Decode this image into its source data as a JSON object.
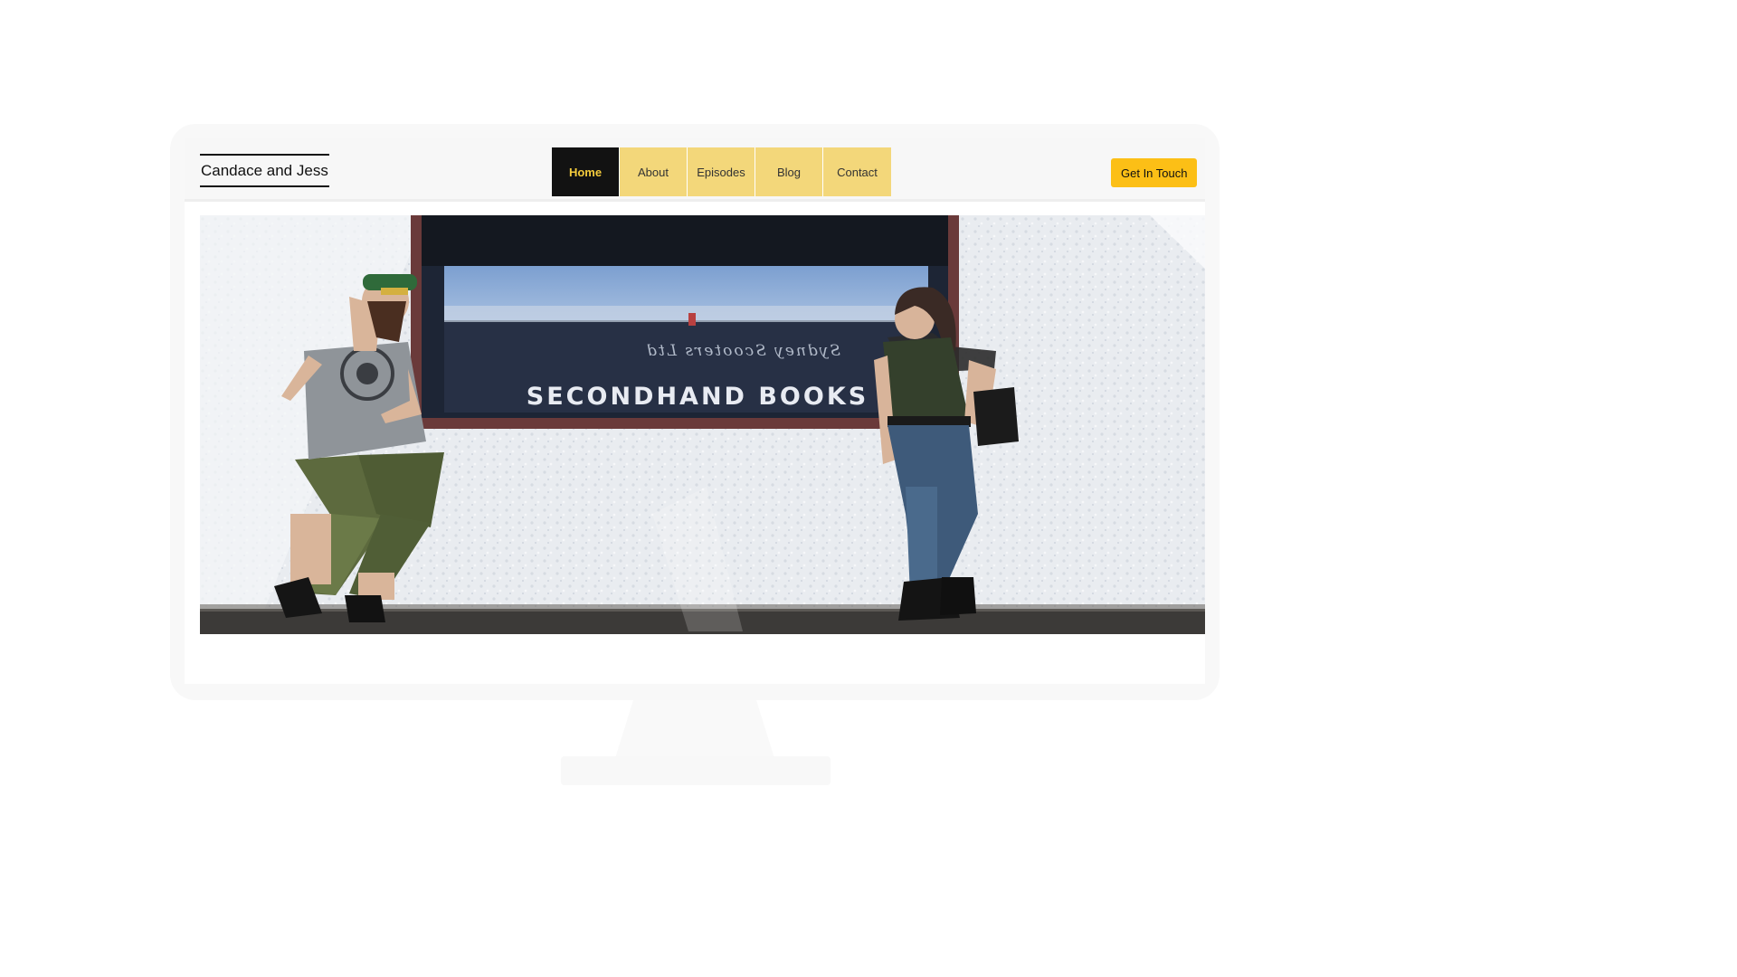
{
  "site": {
    "logo": "Candace and Jess"
  },
  "nav": {
    "items": [
      "Home",
      "About",
      "Episodes",
      "Blog",
      "Contact"
    ],
    "active": "Home"
  },
  "header": {
    "cta_label": "Get In Touch"
  },
  "hero": {
    "sign_text": "SECONDHAND BOOKS",
    "reflection_text": "Sydney Scooters Ltd"
  },
  "colors": {
    "nav_bg": "#f3d77a",
    "nav_active_bg": "#121212",
    "nav_active_text": "#f5cc3c",
    "cta_bg": "#fcbf16",
    "header_bg": "#f7f7f7"
  }
}
